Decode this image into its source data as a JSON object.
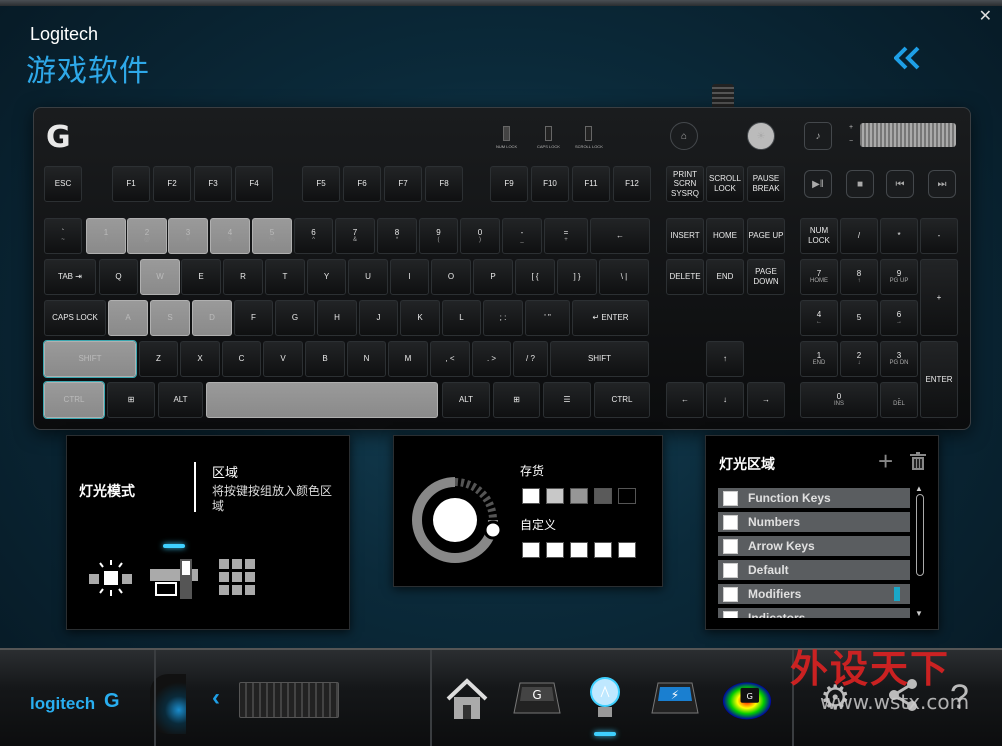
{
  "window": {
    "brand": "Logitech",
    "subtitle": "游戏软件",
    "close_glyph": "✕",
    "collapse_glyph": "«"
  },
  "keyboard": {
    "logo_glyph": "G",
    "locks": [
      "NUM LOCK",
      "CAPS LOCK",
      "SCROLL LOCK"
    ],
    "top_buttons": [
      "game-mode-icon",
      "backlight-icon",
      "mute-icon"
    ],
    "volume": {
      "plus": "+",
      "minus": "−"
    },
    "media": [
      "▶ǁ",
      "■",
      "⏮",
      "⏭"
    ],
    "rows": {
      "fn": [
        "ESC",
        "F1",
        "F2",
        "F3",
        "F4",
        "F5",
        "F6",
        "F7",
        "F8",
        "F9",
        "F10",
        "F11",
        "F12",
        "PRINT SCRN SYSRQ",
        "SCROLL LOCK",
        "PAUSE BREAK"
      ],
      "num": [
        [
          "`",
          "~"
        ],
        [
          "1",
          "!"
        ],
        [
          "2",
          "@"
        ],
        [
          "3",
          "#"
        ],
        [
          "4",
          "$"
        ],
        [
          "5",
          "%"
        ],
        [
          "6",
          "^"
        ],
        [
          "7",
          "&"
        ],
        [
          "8",
          "*"
        ],
        [
          "9",
          "("
        ],
        [
          "0",
          ")"
        ],
        [
          "-",
          "_"
        ],
        [
          "=",
          "+"
        ],
        [
          "←",
          ""
        ]
      ],
      "q": [
        "TAB ⇥",
        "Q",
        "W",
        "E",
        "R",
        "T",
        "Y",
        "U",
        "I",
        "O",
        "P",
        "[ {",
        "] }",
        "\\ |"
      ],
      "a": [
        "CAPS LOCK",
        "A",
        "S",
        "D",
        "F",
        "G",
        "H",
        "J",
        "K",
        "L",
        "; :",
        "' \"",
        "↵ ENTER"
      ],
      "z": [
        "SHIFT",
        "Z",
        "X",
        "C",
        "V",
        "B",
        "N",
        "M",
        ", <",
        ". >",
        "/ ?",
        "SHIFT"
      ],
      "bottom": [
        "CTRL",
        "⊞",
        "ALT",
        "",
        "ALT",
        "⊞",
        "☰",
        "CTRL"
      ],
      "nav": [
        "INSERT",
        "HOME",
        "PAGE UP",
        "DELETE",
        "END",
        "PAGE DOWN"
      ],
      "arrows": [
        "↑",
        "←",
        "↓",
        "→"
      ],
      "numpad": [
        "NUM LOCK",
        "/",
        "*",
        "-",
        "7",
        "8",
        "9",
        "+",
        "4",
        "5",
        "6",
        "1",
        "2",
        "3",
        "ENTER",
        "0",
        ".",
        "HOME",
        "PG UP",
        "END",
        "PG DN",
        "INS",
        "DEL"
      ]
    }
  },
  "lighting_mode_panel": {
    "title": "灯光模式",
    "zone_label": "区域",
    "zone_desc": "将按键按组放入颜色区域",
    "modes": [
      "single-color-icon",
      "zone-icon",
      "per-key-icon"
    ]
  },
  "color_panel": {
    "stock_label": "存货",
    "custom_label": "自定义",
    "stock_colors": [
      "#ffffff",
      "#c8c8c8",
      "#969696",
      "#5a5a5a",
      "#000000"
    ],
    "custom_colors": [
      "#ffffff",
      "#ffffff",
      "#ffffff",
      "#ffffff",
      "#ffffff"
    ]
  },
  "zones_panel": {
    "title": "灯光区域",
    "add": "+",
    "items": [
      "Function Keys",
      "Numbers",
      "Arrow Keys",
      "Default",
      "Modifiers",
      "Indicators"
    ]
  },
  "bottom_bar": {
    "logo_text": "logitech",
    "logo_g": "G",
    "prev_glyph": "‹",
    "nav": [
      "home-icon",
      "g-key-icon",
      "lighting-icon",
      "gkey-blue-icon",
      "heatmap-icon"
    ],
    "utils": [
      "settings-icon",
      "share-icon",
      "help-icon"
    ]
  },
  "watermark": {
    "cn": "外设天下",
    "url": "www.wstx.com"
  }
}
